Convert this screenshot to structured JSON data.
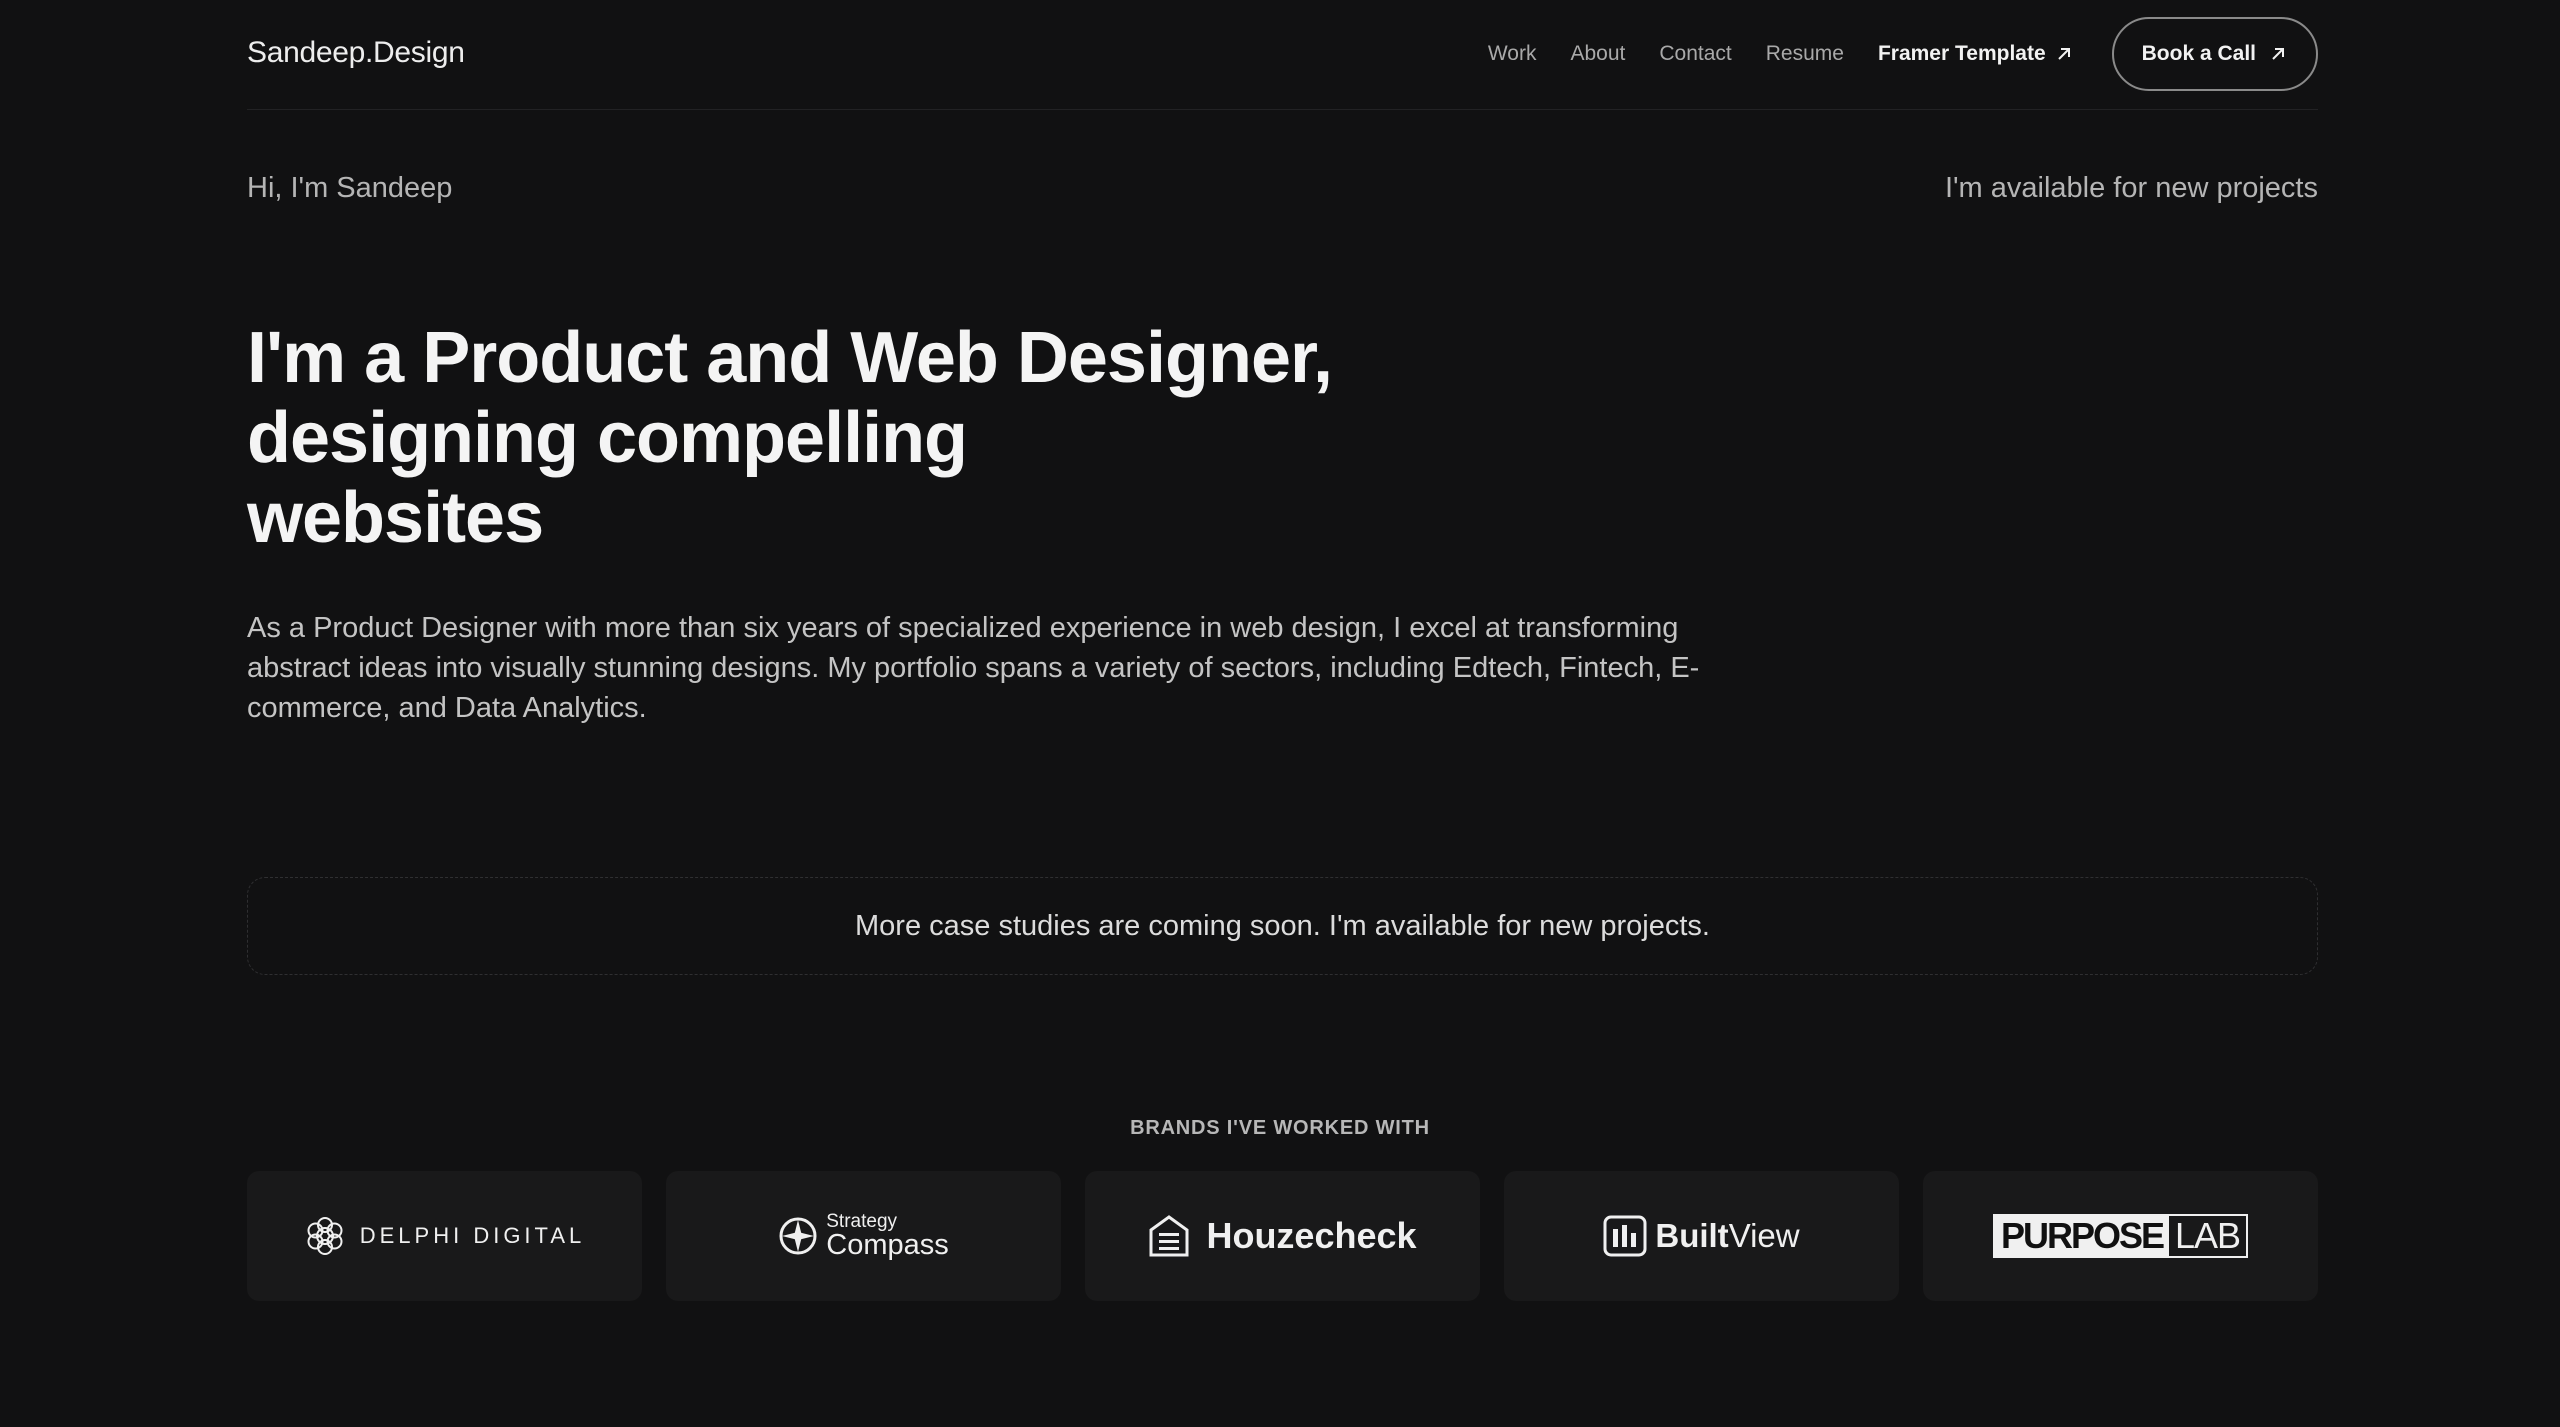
{
  "header": {
    "logo": "Sandeep.Design",
    "nav": [
      "Work",
      "About",
      "Contact",
      "Resume"
    ],
    "framer_template": "Framer Template",
    "cta": "Book a Call"
  },
  "intro": {
    "greeting": "Hi, I'm Sandeep",
    "availability": "I'm available for new projects"
  },
  "hero": {
    "title_line1": "I'm a Product and Web Designer,",
    "title_line2": "designing compelling",
    "title_line3": "websites",
    "description": "As a Product Designer with more than six years of specialized experience in web design, I excel at transforming abstract ideas into visually stunning designs. My portfolio spans a variety of sectors, including Edtech, Fintech, E-commerce, and Data Analytics."
  },
  "notice": "More case studies are coming soon. I'm available for new projects.",
  "brands": {
    "heading": "BRANDS I'VE WORKED WITH",
    "items": [
      {
        "name": "DELPHI DIGITAL",
        "icon": "delphi-logo-icon"
      },
      {
        "name_top": "Strategy",
        "name_bottom": "Compass",
        "icon": "compass-logo-icon"
      },
      {
        "name": "Houzecheck",
        "icon": "house-logo-icon"
      },
      {
        "name_part1": "Built",
        "name_part2": "View",
        "icon": "builtview-logo-icon"
      },
      {
        "name_part1": "PURPOSE",
        "name_part2": "LAB"
      }
    ]
  },
  "colors": {
    "background": "#111112",
    "card": "#19191a",
    "text": "#f1f1f1",
    "muted": "#b5b5b5"
  }
}
